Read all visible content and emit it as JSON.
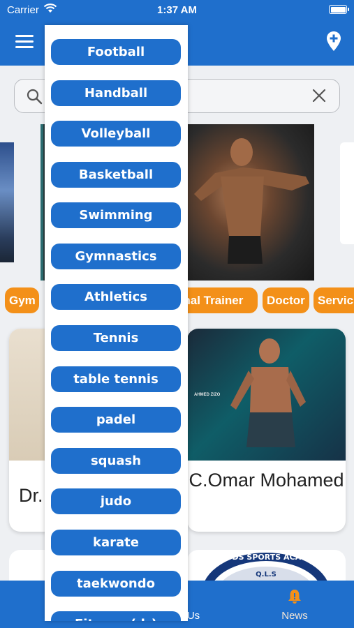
{
  "status_bar": {
    "carrier": "Carrier",
    "time": "1:37 AM",
    "battery_level": 1.0
  },
  "search": {
    "value": "",
    "placeholder": ""
  },
  "categories": [
    "Gym",
    "onal Trainer",
    "Doctor",
    "Servic"
  ],
  "cards": [
    {
      "name": "Dr."
    },
    {
      "name": "C.Omar Mohamed",
      "image_text": "AHMED ZIZO"
    }
  ],
  "lower_card": {
    "logo_top": "QUDS SPORTS ACADE",
    "logo_mid": "Q.L.S"
  },
  "tabs": [
    {
      "label": "Us"
    },
    {
      "label": "News"
    }
  ],
  "sports_menu": [
    "Football",
    "Handball",
    "Volleyball",
    "Basketball",
    "Swimming",
    "Gymnastics",
    "Athletics",
    "Tennis",
    "table tennis",
    "padel",
    "squash",
    "judo",
    "karate",
    "taekwondo",
    "Fitness (dr)"
  ],
  "colors": {
    "primary": "#1f6fcc",
    "accent": "#f39019",
    "news_icon": "#f39019"
  }
}
